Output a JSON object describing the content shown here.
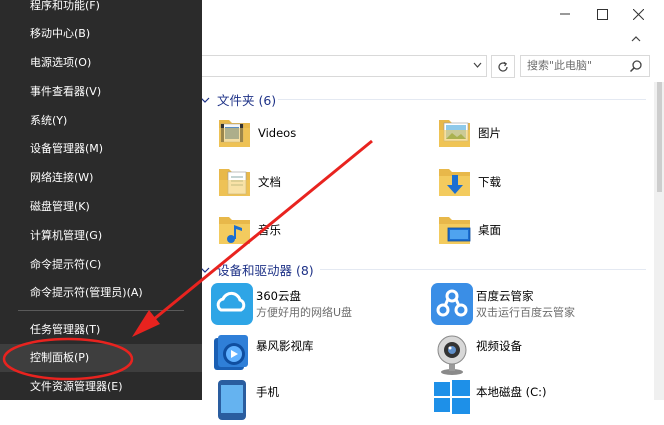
{
  "window": {
    "controls": {
      "minimize": "minimize",
      "maximize": "maximize",
      "close": "close"
    }
  },
  "search": {
    "placeholder": "搜索\"此电脑\""
  },
  "folders": {
    "header": "文件夹 (6)",
    "items": [
      {
        "label": "Videos",
        "icon": "videos-folder-icon"
      },
      {
        "label": "图片",
        "icon": "pictures-folder-icon"
      },
      {
        "label": "文档",
        "icon": "documents-folder-icon"
      },
      {
        "label": "下载",
        "icon": "downloads-folder-icon"
      },
      {
        "label": "音乐",
        "icon": "music-folder-icon"
      },
      {
        "label": "桌面",
        "icon": "desktop-folder-icon"
      }
    ]
  },
  "devices": {
    "header": "设备和驱动器 (8)",
    "items": [
      {
        "name": "360云盘",
        "desc": "方便好用的网络U盘",
        "icon": "cloud-drive-icon"
      },
      {
        "name": "百度云管家",
        "desc": "双击运行百度云管家",
        "icon": "baidu-cloud-icon"
      },
      {
        "name": "暴风影视库",
        "desc": "",
        "icon": "media-library-icon"
      },
      {
        "name": "视频设备",
        "desc": "",
        "icon": "webcam-icon"
      },
      {
        "name": "手机",
        "desc": "",
        "icon": "phone-icon"
      },
      {
        "name": "本地磁盘 (C:)",
        "desc": "",
        "icon": "windows-drive-icon"
      }
    ]
  },
  "winx_menu": {
    "items": [
      {
        "label": "程序和功能(F)"
      },
      {
        "label": "移动中心(B)"
      },
      {
        "label": "电源选项(O)"
      },
      {
        "label": "事件查看器(V)"
      },
      {
        "label": "系统(Y)"
      },
      {
        "label": "设备管理器(M)"
      },
      {
        "label": "网络连接(W)"
      },
      {
        "label": "磁盘管理(K)"
      },
      {
        "label": "计算机管理(G)"
      },
      {
        "label": "命令提示符(C)"
      },
      {
        "label": "命令提示符(管理员)(A)"
      },
      {
        "label": "任务管理器(T)"
      },
      {
        "label": "控制面板(P)"
      },
      {
        "label": "文件资源管理器(E)"
      }
    ],
    "highlighted": "控制面板(P)"
  },
  "colors": {
    "menu_bg": "#2b2b2b",
    "menu_highlight": "#3e3e3e",
    "annotation_red": "#e8231f",
    "section_header": "#1e3287"
  }
}
